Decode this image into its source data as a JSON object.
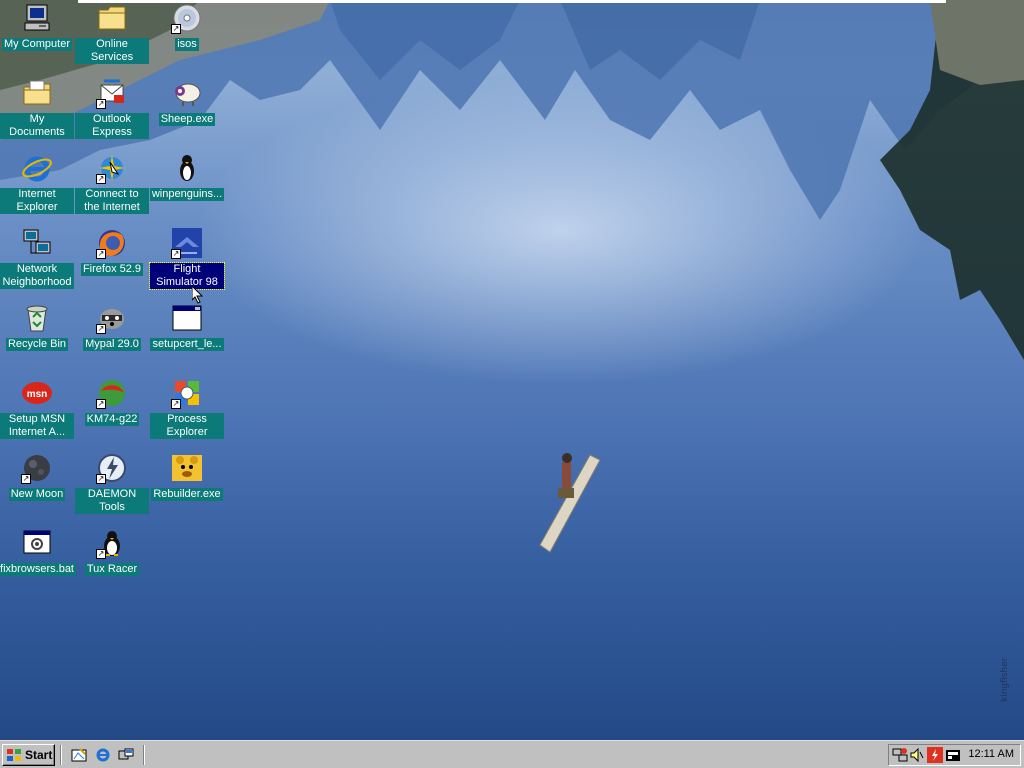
{
  "desktop": {
    "watermark": "kingfisher",
    "icons": [
      {
        "id": "my-computer",
        "label": "My Computer"
      },
      {
        "id": "online-services",
        "label": "Online Services"
      },
      {
        "id": "isos",
        "label": "isos"
      },
      {
        "id": "my-documents",
        "label": "My Documents"
      },
      {
        "id": "outlook-express",
        "label": "Outlook Express"
      },
      {
        "id": "sheep",
        "label": "Sheep.exe"
      },
      {
        "id": "internet-explorer",
        "label": "Internet Explorer"
      },
      {
        "id": "connect-internet",
        "label": "Connect to the Internet"
      },
      {
        "id": "winpenguins",
        "label": "winpenguins..."
      },
      {
        "id": "network-neighborhood",
        "label": "Network Neighborhood"
      },
      {
        "id": "firefox",
        "label": "Firefox 52.9"
      },
      {
        "id": "flight-simulator",
        "label": "Flight Simulator 98",
        "selected": true
      },
      {
        "id": "recycle-bin",
        "label": "Recycle Bin"
      },
      {
        "id": "mypal",
        "label": "Mypal 29.0"
      },
      {
        "id": "setupcert",
        "label": "setupcert_le..."
      },
      {
        "id": "setup-msn",
        "label": "Setup MSN Internet A..."
      },
      {
        "id": "km74",
        "label": "KM74-g22"
      },
      {
        "id": "process-explorer",
        "label": "Process Explorer"
      },
      {
        "id": "new-moon",
        "label": "New Moon"
      },
      {
        "id": "daemon-tools",
        "label": "DAEMON Tools"
      },
      {
        "id": "rebuilder",
        "label": "Rebuilder.exe"
      },
      {
        "id": "fixbrowsers",
        "label": "fixbrowsers.bat"
      },
      {
        "id": "tux-racer",
        "label": "Tux Racer"
      }
    ]
  },
  "taskbar": {
    "start_label": "Start",
    "quick_launch": [
      "show-desktop-icon",
      "internet-explorer-icon",
      "channels-icon"
    ],
    "tray_icons": [
      "network-icon",
      "volume-icon",
      "daemon-tray-icon",
      "task-scheduler-icon"
    ],
    "clock": "12:11 AM"
  },
  "colors": {
    "label_bg": "#0b7a78",
    "selected_bg": "#00007b",
    "taskbar": "#c0c0c0"
  }
}
